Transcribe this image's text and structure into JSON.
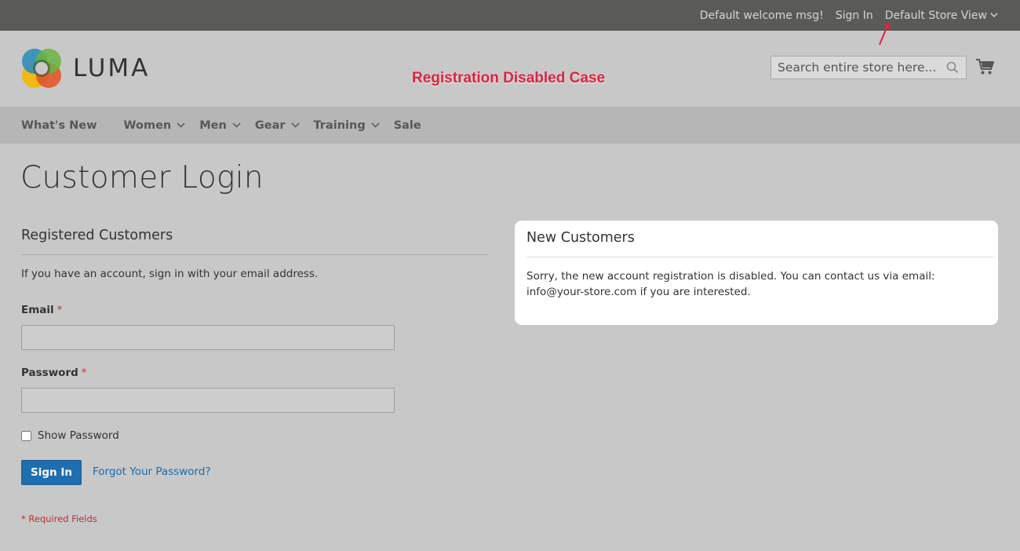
{
  "topbar": {
    "welcome": "Default welcome msg!",
    "signin": "Sign In",
    "store_view": "Default Store View"
  },
  "header": {
    "logo_text": "LUMA",
    "annotation": "Registration Disabled Case",
    "search_placeholder": "Search entire store here..."
  },
  "nav": {
    "items": [
      {
        "label": "What's New"
      },
      {
        "label": "Women"
      },
      {
        "label": "Men"
      },
      {
        "label": "Gear"
      },
      {
        "label": "Training"
      },
      {
        "label": "Sale"
      }
    ]
  },
  "page": {
    "title": "Customer Login"
  },
  "registered": {
    "title": "Registered Customers",
    "intro": "If you have an account, sign in with your email address.",
    "email_label": "Email",
    "password_label": "Password",
    "required_mark": "*",
    "email_value": "",
    "password_value": "",
    "show_password": "Show Password",
    "signin_button": "Sign In",
    "forgot_link": "Forgot Your Password?",
    "required_note": "* Required Fields"
  },
  "new_customers": {
    "title": "New Customers",
    "message": "Sorry, the new account registration is disabled. You can contact us via email: info@your-store.com if you are interested."
  },
  "colors": {
    "accent": "#1f6eb0",
    "annotation": "#e0213f",
    "required": "#e02b27"
  }
}
